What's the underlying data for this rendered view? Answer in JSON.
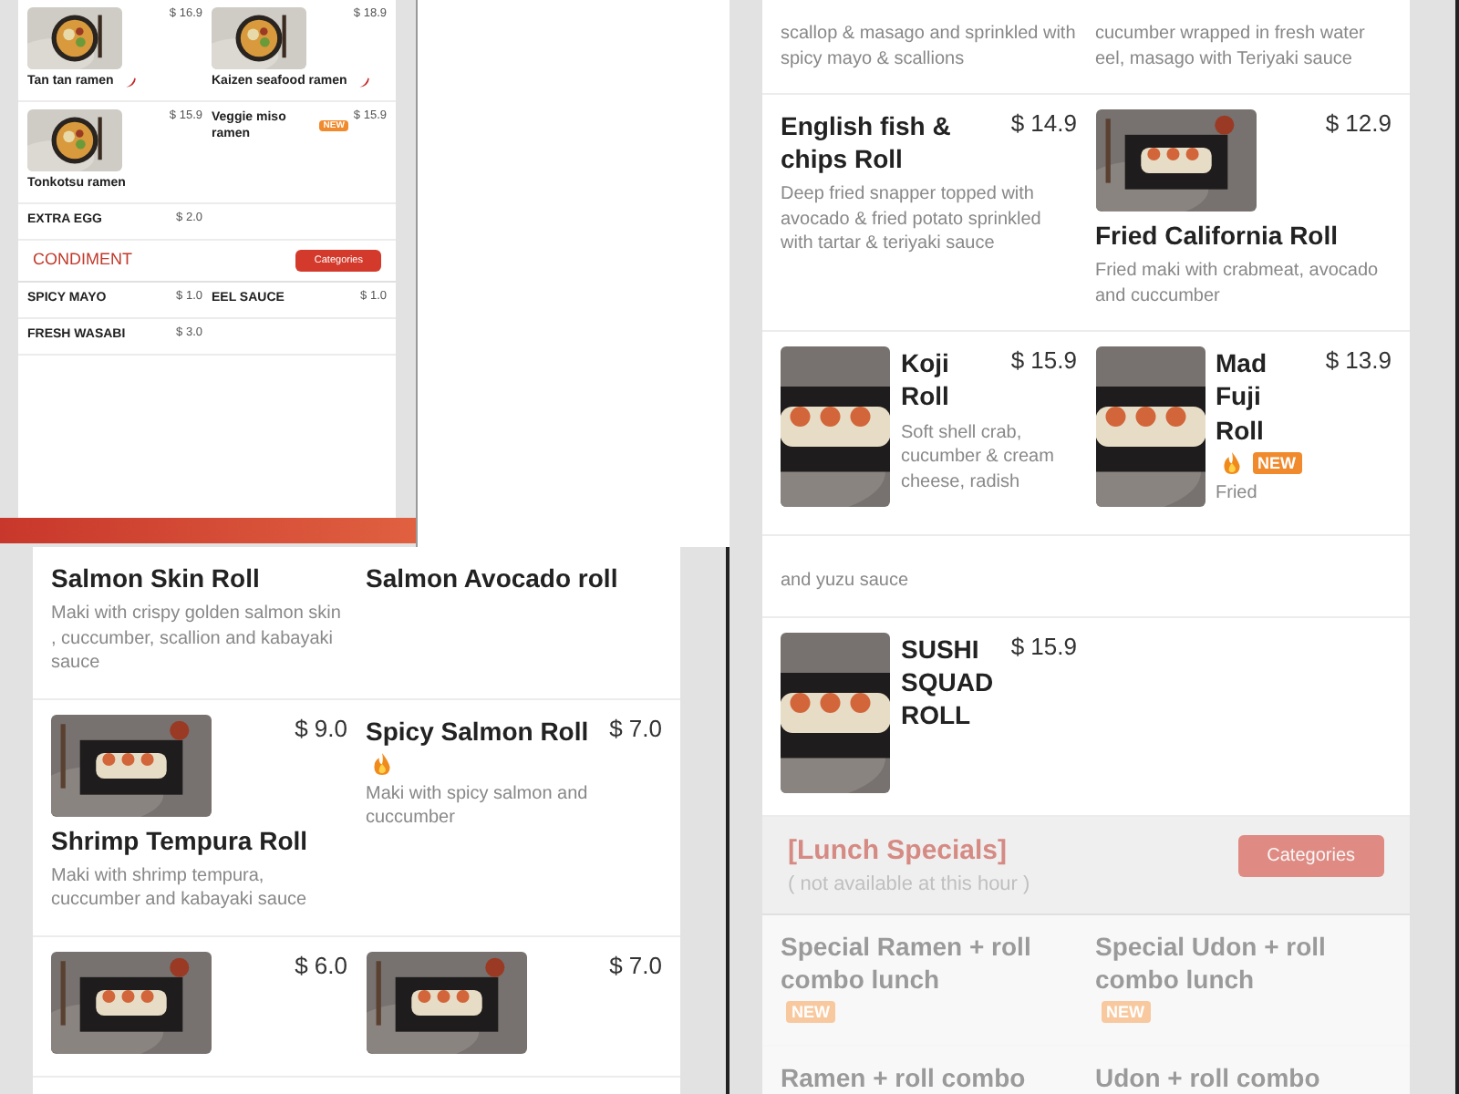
{
  "panels": [
    {
      "kind": "compact",
      "blocks": [
        {
          "kind": "items",
          "items": [
            {
              "kind": "photo-top",
              "name": "Tan tan ramen",
              "price": "$ 16.9",
              "badges": [
                {
                  "kind": "chili"
                }
              ]
            },
            {
              "kind": "photo-top",
              "name": "Kaizen seafood ramen",
              "price": "$ 18.9",
              "badges": [
                {
                  "kind": "chili"
                }
              ]
            }
          ]
        },
        {
          "kind": "items",
          "items": [
            {
              "kind": "photo-top",
              "name": "Tonkotsu ramen",
              "price": "$ 15.9"
            },
            {
              "kind": "text",
              "name": "Veggie miso ramen",
              "price": "$ 15.9",
              "badges": [
                {
                  "kind": "new",
                  "text": "NEW"
                }
              ]
            }
          ]
        },
        {
          "kind": "items",
          "items": [
            {
              "kind": "text",
              "name": "EXTRA EGG",
              "price": "$ 2.0"
            }
          ]
        },
        {
          "kind": "section",
          "title": "CONDIMENT",
          "button": "Categories",
          "disabled": false
        },
        {
          "kind": "items",
          "items": [
            {
              "kind": "text",
              "name": "SPICY MAYO",
              "price": "$ 1.0"
            },
            {
              "kind": "text",
              "name": "EEL SAUCE",
              "price": "$ 1.0"
            }
          ]
        },
        {
          "kind": "items",
          "items": [
            {
              "kind": "text",
              "name": "FRESH WASABI",
              "price": "$ 3.0"
            }
          ]
        }
      ]
    },
    {
      "kind": "regular",
      "blocks": [
        {
          "kind": "items",
          "items": [
            {
              "kind": "text",
              "description": "scallop & masago and sprinkled with spicy mayo & scallions"
            },
            {
              "kind": "text",
              "description": "cucumber wrapped in fresh water eel, masago with Teriyaki sauce"
            }
          ]
        },
        {
          "kind": "items",
          "items": [
            {
              "kind": "text",
              "name": "English fish & chips Roll",
              "price": "$ 14.9",
              "description": "Deep fried snapper topped with avocado & fried potato sprinkled with tartar & teriyaki sauce"
            },
            {
              "kind": "photo-top",
              "name": "Fried California Roll",
              "price": "$ 12.9",
              "description": "Fried maki with crabmeat, avocado and cuccumber"
            }
          ]
        },
        {
          "kind": "items",
          "items": [
            {
              "kind": "photo-side",
              "name": "Koji Roll",
              "price": "$ 15.9",
              "description": "Soft shell crab, cucumber & cream cheese, radish"
            },
            {
              "kind": "photo-side",
              "name": "Mad Fuji Roll",
              "price": "$ 13.9",
              "badges": [
                {
                  "kind": "fire"
                },
                {
                  "kind": "new",
                  "text": "NEW"
                }
              ],
              "description": "Fried"
            }
          ]
        }
      ]
    },
    {
      "kind": "regular",
      "blocks": [
        {
          "kind": "items",
          "items": [
            {
              "kind": "text",
              "name": "Salmon Skin Roll",
              "description": "Maki with crispy golden salmon skin , cuccumber, scallion and kabayaki sauce"
            },
            {
              "kind": "text",
              "name": "Salmon Avocado roll"
            }
          ]
        },
        {
          "kind": "items",
          "items": [
            {
              "kind": "photo-top",
              "name": "Shrimp Tempura Roll",
              "price": "$ 9.0",
              "description": "Maki with shrimp tempura, cuccumber and kabayaki sauce"
            },
            {
              "kind": "text",
              "name": "Spicy Salmon Roll",
              "price": "$ 7.0",
              "badges": [
                {
                  "kind": "fire"
                }
              ],
              "description": "Maki with spicy salmon and cuccumber"
            }
          ]
        },
        {
          "kind": "items",
          "items": [
            {
              "kind": "photo-top",
              "price": "$ 6.0"
            },
            {
              "kind": "photo-top",
              "price": "$ 7.0"
            }
          ]
        }
      ]
    },
    {
      "kind": "regular",
      "blocks": [
        {
          "kind": "items",
          "items": [
            {
              "kind": "text",
              "description": "and yuzu sauce"
            }
          ]
        },
        {
          "kind": "items",
          "items": [
            {
              "kind": "photo-side",
              "name": "SUSHI SQUAD ROLL",
              "price": "$ 15.9"
            }
          ]
        },
        {
          "kind": "section",
          "title": "[Lunch Specials]",
          "note": "( not available at this hour )",
          "button": "Categories",
          "disabled": true
        },
        {
          "kind": "items",
          "disabled": true,
          "items": [
            {
              "kind": "text",
              "name": "Special Ramen + roll combo lunch",
              "badges": [
                {
                  "kind": "new",
                  "text": "NEW"
                }
              ]
            },
            {
              "kind": "text",
              "name": "Special Udon + roll combo lunch",
              "badges": [
                {
                  "kind": "new",
                  "text": "NEW"
                }
              ]
            }
          ]
        },
        {
          "kind": "items",
          "disabled": true,
          "items": [
            {
              "kind": "text",
              "name": "Ramen + roll combo"
            },
            {
              "kind": "text",
              "name": "Udon + roll combo"
            }
          ]
        }
      ]
    }
  ]
}
